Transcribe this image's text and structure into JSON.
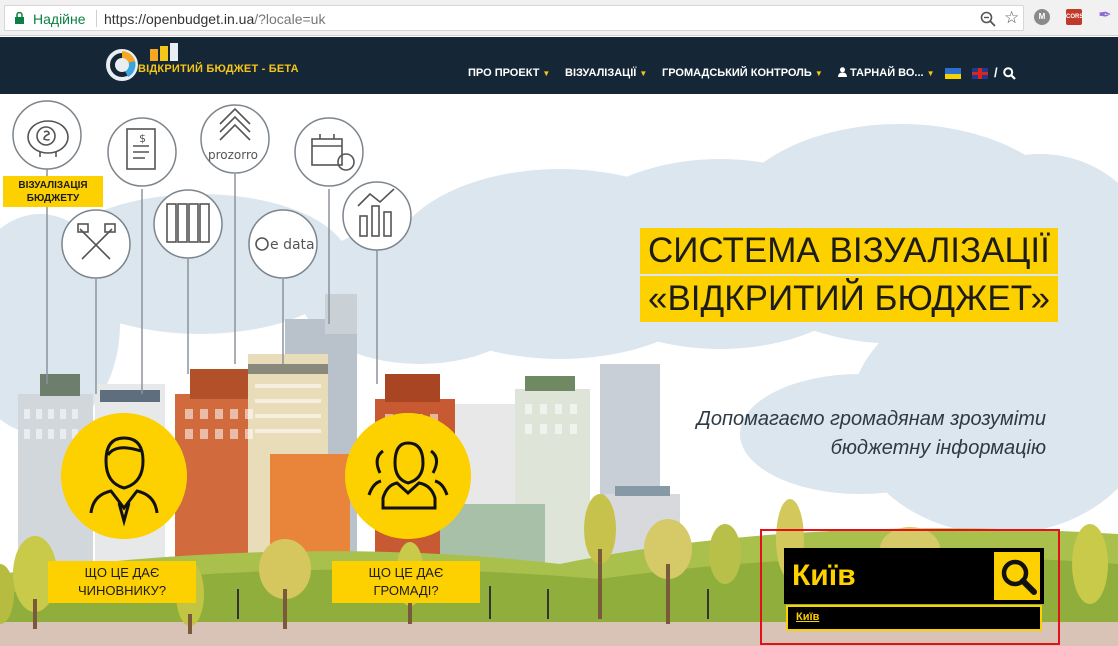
{
  "browser": {
    "secure_label": "Надійне",
    "url_host": "https://openbudget.in.ua",
    "url_rest": "/?locale=uk",
    "extensions": [
      "М",
      "CORS",
      "✒"
    ]
  },
  "header": {
    "logo_text": "ВІДКРИТИЙ БЮДЖЕТ - БЕТА",
    "nav": [
      {
        "label": "ПРО ПРОЕКТ"
      },
      {
        "label": "ВІЗУАЛІЗАЦІЇ"
      },
      {
        "label": "ГРОМАДСЬКИЙ КОНТРОЛЬ"
      },
      {
        "label": "ТАРНАЙ ВО..."
      }
    ],
    "languages": [
      "uk",
      "en"
    ]
  },
  "hero": {
    "title_line1": "СИСТЕМА ВІЗУАЛІЗАЦІЇ",
    "title_line2": "«ВІДКРИТИЙ БЮДЖЕТ»",
    "subtitle_line1": "Допомагаємо громадянам зрозуміти",
    "subtitle_line2": "бюджетну інформацію",
    "vis_label_line1": "ВІЗУАЛІЗАЦІЯ",
    "vis_label_line2": "БЮДЖЕТУ",
    "icons": {
      "prozorro": "prozorro",
      "edata": "e data"
    },
    "officials_line1": "ЩО ЦЕ ДАЄ",
    "officials_line2": "ЧИНОВНИКУ?",
    "community_line1": "ЩО ЦЕ ДАЄ",
    "community_line2": "ГРОМАДІ?"
  },
  "search": {
    "value": "Київ",
    "suggestion": "Київ"
  },
  "colors": {
    "accent": "#fdd000",
    "header_bg": "#152736",
    "highlight": "#e3101c"
  }
}
